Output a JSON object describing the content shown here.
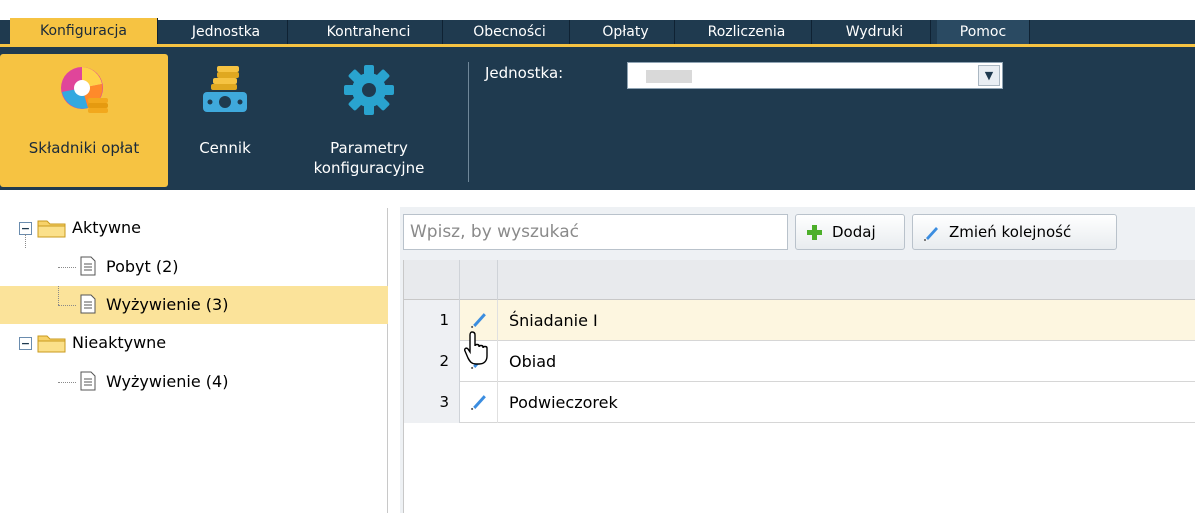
{
  "menu": {
    "tabs": [
      "Konfiguracja",
      "Jednostka",
      "Kontrahenci",
      "Obecności",
      "Opłaty",
      "Rozliczenia",
      "Wydruki",
      "Pomoc"
    ],
    "active": "Konfiguracja"
  },
  "ribbon": {
    "buttons": [
      {
        "label": "Składniki opłat",
        "icon": "fee-components-icon",
        "active": true
      },
      {
        "label": "Cennik",
        "icon": "price-list-icon",
        "active": false
      },
      {
        "label": "Parametry konfiguracyjne",
        "icon": "gear-icon",
        "active": false
      }
    ],
    "unit_label": "Jednostka:",
    "unit_value": ""
  },
  "tree": {
    "groups": [
      {
        "label": "Aktywne",
        "children": [
          {
            "label": "Pobyt (2)"
          },
          {
            "label": "Wyżywienie (3)",
            "selected": true
          }
        ]
      },
      {
        "label": "Nieaktywne",
        "children": [
          {
            "label": "Wyżywienie (4)"
          }
        ]
      }
    ],
    "collapse_symbol": "−"
  },
  "toolbar": {
    "search_placeholder": "Wpisz, by wyszukać",
    "add_label": "Dodaj",
    "reorder_label": "Zmień kolejność"
  },
  "grid": {
    "rows": [
      {
        "num": "1",
        "name": "Śniadanie I"
      },
      {
        "num": "2",
        "name": "Obiad"
      },
      {
        "num": "3",
        "name": "Podwieczorek"
      }
    ]
  },
  "colors": {
    "nav_bg": "#1f3a4f",
    "accent": "#f6c342",
    "selection": "#fbe39a"
  }
}
